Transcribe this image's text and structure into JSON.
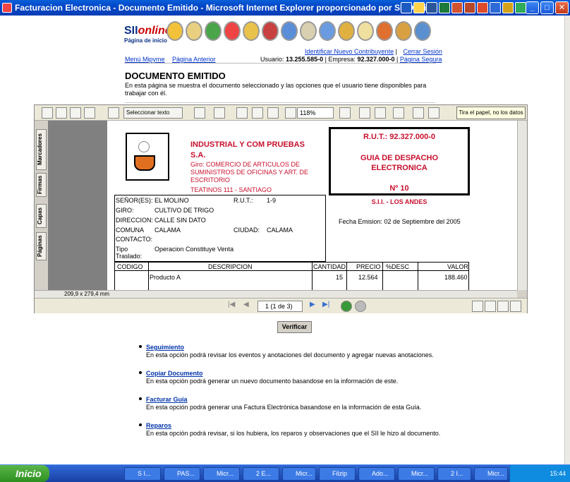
{
  "window": {
    "title": "Facturacion Electronica - Documento Emitido - Microsoft Internet Explorer proporcionado por SII OnLine",
    "controls": {
      "minimize": "_",
      "maximize": "□",
      "close": "✕"
    }
  },
  "header": {
    "logo_brand": "SII",
    "logo_brand2": "online",
    "logo_home": "Página de inicio",
    "link_new_contributor": "Identificar Nuevo Contribuyente",
    "link_logout": "Cerrar Sesión",
    "link_menu": "Menú Mipyme",
    "link_prev": "Página Anterior",
    "user_label": "Usuario:",
    "user_value": "13.255.585-0",
    "company_label": "Empresa:",
    "company_value": "92.327.000-0",
    "link_secure": "Página Segura"
  },
  "page": {
    "title": "DOCUMENTO EMITIDO",
    "subtitle": "En esta página se muestra el documento seleccionado y las opciones que el usuario tiene disponibles para trabajar con él."
  },
  "pdf_toolbar": {
    "select_text": "Seleccionar texto",
    "zoom": "118%",
    "tip": "Tira el papel, no los datos"
  },
  "pdf_sidetabs": [
    "Marcadores",
    "Firmas",
    "Capas",
    "Páginas"
  ],
  "pdf_nav": {
    "page_indicator": "1 (1 de 3)",
    "page_size": "209,9 x 279,4 mm"
  },
  "document": {
    "company_name_1": "INDUSTRIAL Y COM PRUEBAS",
    "company_name_2": "S.A.",
    "giro_1": "Giro: COMERCIO DE ARTICULOS DE",
    "giro_2": "SUMINISTROS DE OFICINAS Y ART. DE",
    "giro_3": "ESCRITORIO",
    "address": "TEATINOS 111 - SANTIAGO",
    "rut_box": "R.U.T.: 92.327.000-0",
    "doc_type_1": "GUIA DE DESPACHO",
    "doc_type_2": "ELECTRONICA",
    "doc_number": "Nº 10",
    "sii_office": "S.I.I. - LOS ANDES",
    "emission_label": "Fecha Emision:",
    "emission_date": "02 de Septiembre del 2005",
    "fields": {
      "senor_label": "SEÑOR(ES):",
      "senor": "EL MOLINO",
      "rut_label": "R.U.T.:",
      "rut": "1-9",
      "giro_label": "GIRO:",
      "giro": "CULTIVO DE TRIGO",
      "dir_label": "DIRECCION:",
      "dir": "CALLE SIN DATO",
      "comuna_label": "COMUNA",
      "comuna": "CALAMA",
      "ciudad_label": "CIUDAD:",
      "ciudad": "CALAMA",
      "contacto_label": "CONTACTO:",
      "tipo_label_1": "Tipo",
      "tipo_label_2": "Traslado:",
      "tipo": "Operacion Constituye Venta"
    },
    "table_headers": [
      "CODIGO",
      "DESCRIPCION",
      "CANTIDAD",
      "PRECIO",
      "%DESC",
      "VALOR"
    ],
    "rows": [
      {
        "codigo": "",
        "descripcion": "Producto A",
        "cantidad": "15",
        "precio": "12.564",
        "desc": "",
        "valor": "188.460"
      }
    ]
  },
  "verify_button": "Verificar",
  "options": [
    {
      "link": "Seguimiento",
      "desc": "En esta opción podrá revisar los eventos y anotaciones del documento y agregar nuevas anotaciones."
    },
    {
      "link": "Copiar Documento",
      "desc": "En esta opción podrá generar un nuevo documento basandose en la información de este."
    },
    {
      "link": "Facturar Guía",
      "desc": "En esta opción podrá generar una Factura Electrónica basandose en la información de esta Guía."
    },
    {
      "link": "Reparos",
      "desc": "En esta opción podrá revisar, si los hubiera, los reparos y observaciones que el SII le hizo al documento."
    }
  ],
  "taskbar": {
    "start": "Inicio",
    "tasks": [
      "S I...",
      "PAS...",
      "Micr...",
      "2 E...",
      "Micr...",
      "Filzip",
      "Ado...",
      "Micr...",
      "2 I...",
      "Micr..."
    ],
    "clock": "15:44"
  },
  "colors": {
    "accent_red": "#c8102e",
    "link_blue": "#0033cc",
    "title_blue": "#0a3fb6"
  }
}
